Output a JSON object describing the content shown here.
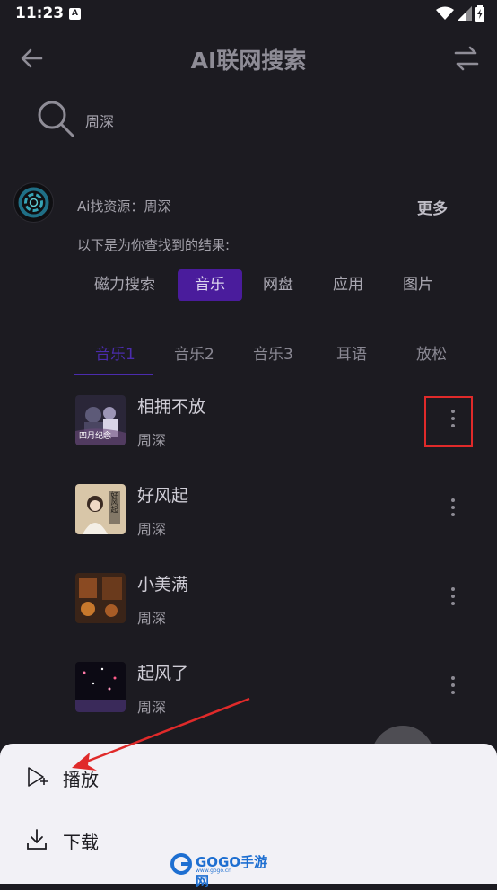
{
  "status_bar": {
    "time": "11:23",
    "notification": "A"
  },
  "app_bar": {
    "title": "AI联网搜索"
  },
  "search": {
    "query": "周深"
  },
  "ai": {
    "resource_label": "Ai找资源：",
    "resource_query": "周深",
    "more_label": "更多",
    "result_text": "以下是为你查找到的结果:"
  },
  "categories": [
    {
      "label": "磁力搜索",
      "active": false
    },
    {
      "label": "音乐",
      "active": true
    },
    {
      "label": "网盘",
      "active": false
    },
    {
      "label": "应用",
      "active": false
    },
    {
      "label": "图片",
      "active": false
    }
  ],
  "tabs": [
    {
      "label": "音乐1",
      "active": true
    },
    {
      "label": "音乐2",
      "active": false
    },
    {
      "label": "音乐3",
      "active": false
    },
    {
      "label": "耳语",
      "active": false
    },
    {
      "label": "放松",
      "active": false
    }
  ],
  "songs": [
    {
      "title": "相拥不放",
      "artist": "周深",
      "cover_text": "四月纪念"
    },
    {
      "title": "好风起",
      "artist": "周深",
      "cover_text": "好风起"
    },
    {
      "title": "小美满",
      "artist": "周深",
      "cover_text": ""
    },
    {
      "title": "起风了",
      "artist": "周深",
      "cover_text": ""
    }
  ],
  "sheet": {
    "play_label": "播放",
    "download_label": "下载"
  },
  "watermark": {
    "text": "GOGO手游网",
    "sub": "www.gogo.cn"
  },
  "colors": {
    "background": "#1c1b21",
    "accent": "#4b2cae",
    "chip_active": "#4a1c9c",
    "annotation": "#e02a2a",
    "sheet": "#f2f1f6"
  }
}
